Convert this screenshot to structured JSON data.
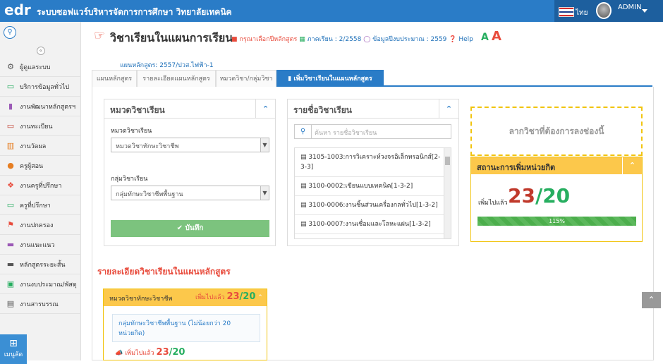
{
  "app": {
    "logo_text": "edr",
    "title": "ระบบซอฟแวร์บริหารจัดการการศึกษา วิทยาลัยเทคนิค",
    "lang": "ไทย",
    "user": "ADMIN"
  },
  "sidebar": {
    "collapse_glyph": "«",
    "items": [
      {
        "label": "ผู้ดูแลระบบ",
        "icon": "cog-icon",
        "color": "#555"
      },
      {
        "label": "บริการข้อมูลทั่วไป",
        "icon": "monitor-icon",
        "color": "#27ae60"
      },
      {
        "label": "งานพัฒนาหลักสูตรฯ",
        "icon": "book-icon",
        "color": "#9b59b6"
      },
      {
        "label": "งานทะเบียน",
        "icon": "screen-icon",
        "color": "#c0392b"
      },
      {
        "label": "งานวัดผล",
        "icon": "chart-icon",
        "color": "#e67e22"
      },
      {
        "label": "ครูผู้สอน",
        "icon": "user-icon",
        "color": "#e67e22"
      },
      {
        "label": "งานครูที่ปรึกษา",
        "icon": "users-icon",
        "color": "#e84c3d"
      },
      {
        "label": "ครูที่ปรึกษา",
        "icon": "laptop-icon",
        "color": "#27ae60"
      },
      {
        "label": "งานปกครอง",
        "icon": "flag-icon",
        "color": "#e84c3d"
      },
      {
        "label": "งานแนะแนว",
        "icon": "briefcase-icon",
        "color": "#9b59b6"
      },
      {
        "label": "หลักสูตรระยะสั้น",
        "icon": "briefcase-icon",
        "color": "#555"
      },
      {
        "label": "งานงบประมาณ/พัสดุ",
        "icon": "money-icon",
        "color": "#27ae60"
      },
      {
        "label": "งานสารบรรณ",
        "icon": "archive-icon",
        "color": "#555"
      }
    ],
    "menu_button": "เมนูลัด"
  },
  "page": {
    "title": "วิชาเรียนในแผนการเรียน",
    "choose_curriculum": "กรุณาเลือกปีหลักสูตร",
    "semester": "ภาคเรียน : 2/2558",
    "budget_year": "ข้อมูลปีงบประมาณ : 2559",
    "help": "Help",
    "font_small": "A",
    "font_large": "A",
    "curriculum": "แผนหลักสูตร: 2557/ปวส.ไฟฟ้า-1"
  },
  "tabs": [
    "แผนหลักสูตร",
    "รายละเอียดแผนหลักสูตร",
    "หมวดวิชา/กลุ่มวิชา",
    "เพิ่มวิชาเรียนในแผนหลักสูตร"
  ],
  "category_panel": {
    "title": "หมวดวิชาเรียน",
    "cat_label": "หมวดวิชาเรียน",
    "cat_value": "หมวดวิชาทักษะวิชาชีพ",
    "group_label": "กลุ่มวิชาเรียน",
    "group_value": "กลุ่มทักษะวิชาชีพพื้นฐาน",
    "save": "บันทึก"
  },
  "subject_panel": {
    "title": "รายชื่อวิชาเรียน",
    "search_placeholder": "ค้นหา รายชื่อวิชาเรียน",
    "subjects": [
      "3105-1003:การวิเคราะห์วงจรอิเล็กทรอนิกส์[2-3-3]",
      "3100-0002:เขียนแบบเทคนิค[1-3-2]",
      "3100-0006:งานชิ้นส่วนเครื่องกลทั่วไป[1-3-2]",
      "3100-0007:งานเชื่อมและโลหะแผ่น[1-3-2]"
    ]
  },
  "drop_zone": "ลากวิชาที่ต้องการลงช่องนี้",
  "status": {
    "title": "สถานะการเพิ่มหน่วยกิต",
    "added_label": "เพิ่มไปแล้ว",
    "added": "23",
    "required": "20",
    "percent_label": "115%",
    "fraction": 1.0
  },
  "details": {
    "title": "รายละเอียดวิชาเรียนในแผนหลักสูตร",
    "group_title": "หมวดวิชาทักษะวิชาชีพ",
    "group_added_label": "เพิ่มไปแล้ว",
    "group_added": "23",
    "group_required": "20",
    "subgroup": "กลุ่มทักษะวิชาชีพพื้นฐาน (ไม่น้อยกว่า 20 หน่วยกิต)",
    "sub_added_label": "เพิ่มไปแล้ว",
    "sub_added": "23",
    "sub_required": "20"
  },
  "colors": {
    "primary": "#2a7cc7",
    "accent_red": "#e84c3d",
    "ok_green": "#27ae60",
    "warn_yellow": "#fcc84b"
  }
}
